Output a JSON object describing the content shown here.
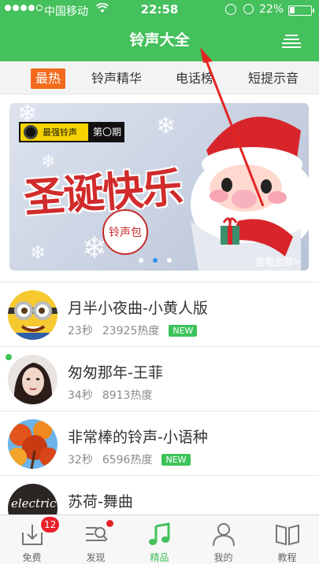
{
  "status_bar": {
    "carrier": "中国移动",
    "time": "22:58",
    "battery_pct": "22%",
    "battery_level": 0.22,
    "icons": [
      "signal-icon",
      "wifi-icon",
      "orientation-lock-icon",
      "alarm-icon",
      "battery-icon"
    ]
  },
  "header": {
    "title": "铃声大全",
    "menu_icon": "menu-icon",
    "color": "#44c05c"
  },
  "tabs": [
    {
      "label": "最热",
      "active": true
    },
    {
      "label": "铃声精华",
      "active": false
    },
    {
      "label": "电话榜",
      "active": false
    },
    {
      "label": "短提示音",
      "active": false
    }
  ],
  "banner": {
    "logo_text": "最强铃声",
    "issue_label": "第",
    "issue_suffix": "期",
    "headline": "圣诞快乐",
    "stamp": "铃声包",
    "see_all": "查看全部>",
    "page_count": 3,
    "active_page": 2
  },
  "songs": [
    {
      "title": "月半小夜曲-小黄人版",
      "duration": "23秒",
      "heat": "23925热度",
      "badge": "NEW",
      "avatar": "minion-avatar"
    },
    {
      "title": "匆匆那年-王菲",
      "duration": "34秒",
      "heat": "8913热度",
      "badge": "",
      "avatar": "singer-avatar",
      "dot": true
    },
    {
      "title": "非常棒的铃声-小语种",
      "duration": "32秒",
      "heat": "6596热度",
      "badge": "NEW",
      "avatar": "autumn-leaves-avatar"
    },
    {
      "title": "苏荷-舞曲",
      "duration": "",
      "heat": "",
      "badge": "",
      "avatar": "electric-avatar"
    }
  ],
  "avatar_text": {
    "electric": "electric"
  },
  "bottom_nav": [
    {
      "label": "免费",
      "icon": "download-icon",
      "badge": "12",
      "active": false
    },
    {
      "label": "发现",
      "icon": "discover-icon",
      "dot": true,
      "active": false
    },
    {
      "label": "精品",
      "icon": "music-note-icon",
      "active": true
    },
    {
      "label": "我的",
      "icon": "user-icon",
      "active": false
    },
    {
      "label": "教程",
      "icon": "book-icon",
      "active": false
    }
  ],
  "colors": {
    "accent": "#44c05c",
    "active_tab": "#f26b1d",
    "badge": "#e8202a",
    "new_badge": "#3cc35a"
  }
}
